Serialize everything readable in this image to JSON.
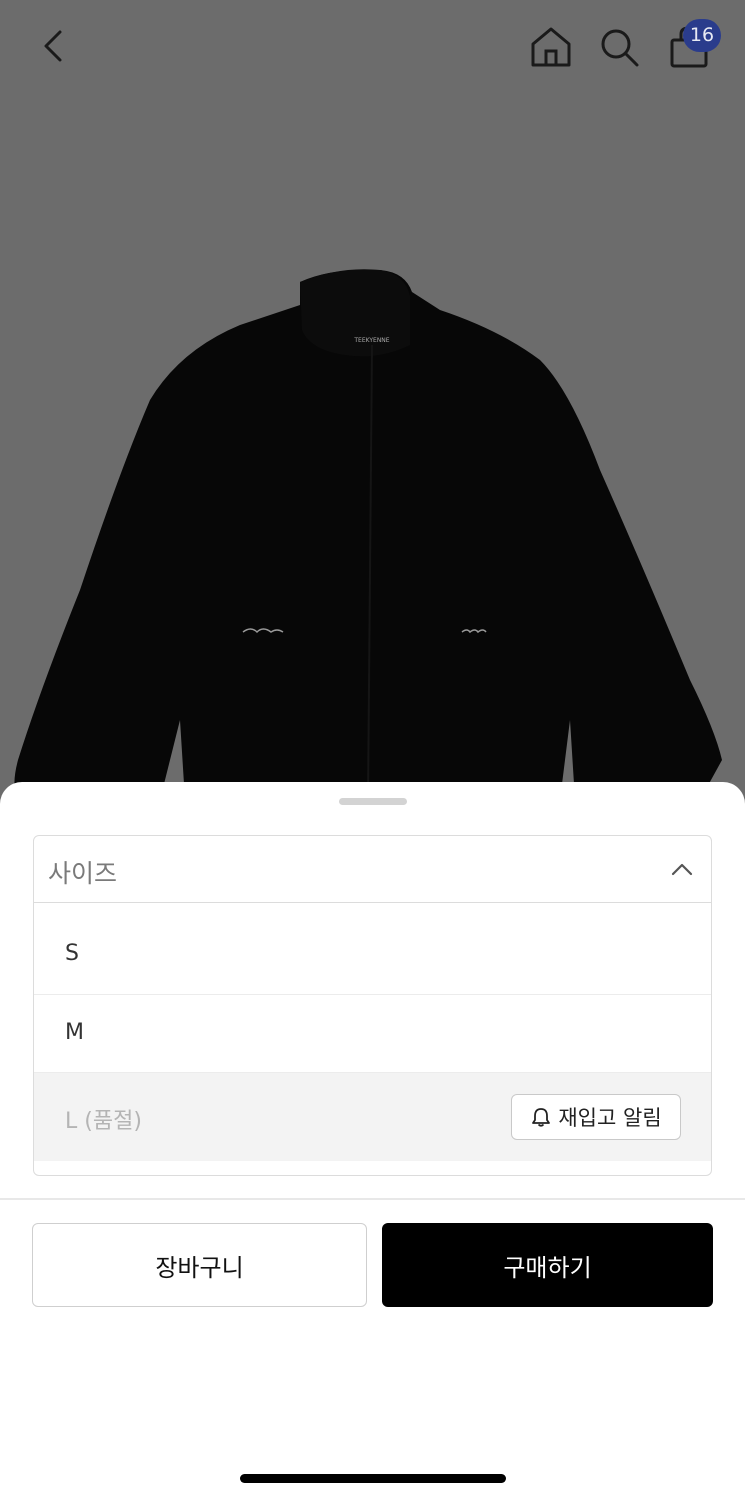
{
  "header": {
    "cart_count": "16",
    "icons": [
      "back-arrow-icon",
      "home-icon",
      "search-icon",
      "shopping-bag-icon"
    ]
  },
  "product": {
    "image_label": "TEEKYENNE"
  },
  "sheet": {
    "select": {
      "label": "사이즈",
      "options": [
        {
          "label": "S",
          "available": true
        },
        {
          "label": "M",
          "available": true
        },
        {
          "label": "L (품절)",
          "available": false
        }
      ],
      "restock_label": "재입고 알림"
    },
    "add_to_cart_label": "장바구니",
    "buy_label": "구매하기"
  },
  "colors": {
    "badge": "#2a3c8c",
    "buy_button": "#000000",
    "overlay": "#6c6c6c"
  }
}
